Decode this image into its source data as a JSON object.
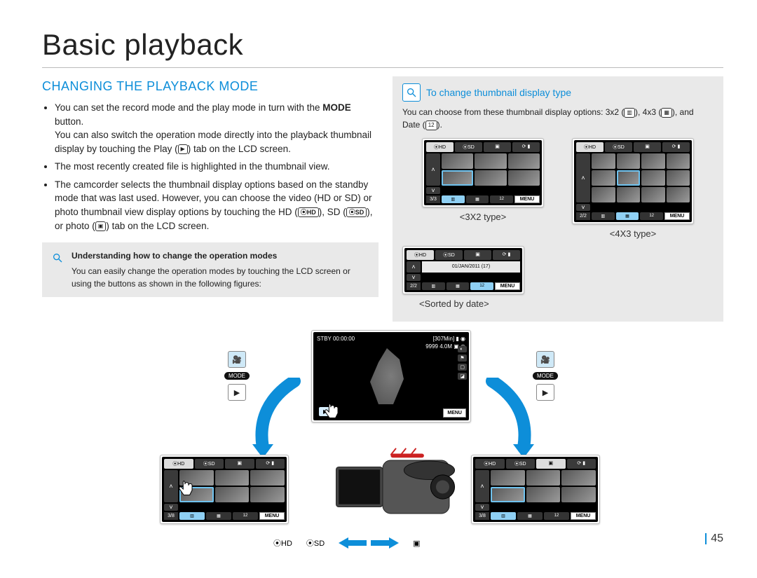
{
  "page": {
    "title": "Basic playback",
    "section_title": "CHANGING THE PLAYBACK MODE",
    "page_number": "45"
  },
  "bullets": {
    "b1a": "You can set the record mode and the play mode in turn with the ",
    "b1b": "MODE",
    "b1c": " button.",
    "b1d": "You can also switch the operation mode directly into the playback thumbnail display by touching the Play (",
    "b1e": ") tab on the LCD screen.",
    "b2": "The most recently created file is highlighted in the thumbnail view.",
    "b3a": "The camcorder selects the thumbnail display options based on the standby mode that was last used. However, you can choose the video (HD or SD) or photo thumbnail view display options by touching the HD (",
    "b3b": "), SD (",
    "b3c": "), or photo (",
    "b3d": ") tab on the LCD screen."
  },
  "note": {
    "title": "Understanding how to change the operation modes",
    "body": "You can easily change the operation modes by touching the LCD screen or using the buttons as shown in the following figures:"
  },
  "rightbox": {
    "heading": "To change thumbnail display type",
    "intro": "You can choose from these thumbnail display options: 3x2 (",
    "intro2": "), 4x3 (",
    "intro3": "), and Date (",
    "intro4": ").",
    "cap_3x2": "<3X2 type>",
    "cap_4x3": "<4X3 type>",
    "cap_date": "<Sorted by date>"
  },
  "lcd": {
    "tab_hd": "⦿HD",
    "tab_sd": "⦿SD",
    "tab_photo": "▣",
    "tab_status": "⟳ ▮",
    "menu": "MENU",
    "page_3_3": "3/3",
    "page_2_2": "2/2",
    "page_3_8": "3/8",
    "up": "˄",
    "down": "˅",
    "foot_3x2": "▥",
    "foot_4x3": "▦",
    "foot_date": "12",
    "date_entry": "01/JAN/2011 (17)",
    "stby": "STBY 00:00:00",
    "stby_right": "[307Min] ▮ ◉",
    "stby_sub": "9999 4.0M ▣ ◷",
    "play_label": "▶"
  },
  "bottom": {
    "mode_label": "MODE",
    "hd_label": "⦿HD",
    "sd_label": "⦿SD",
    "photo_icon": "▣"
  }
}
